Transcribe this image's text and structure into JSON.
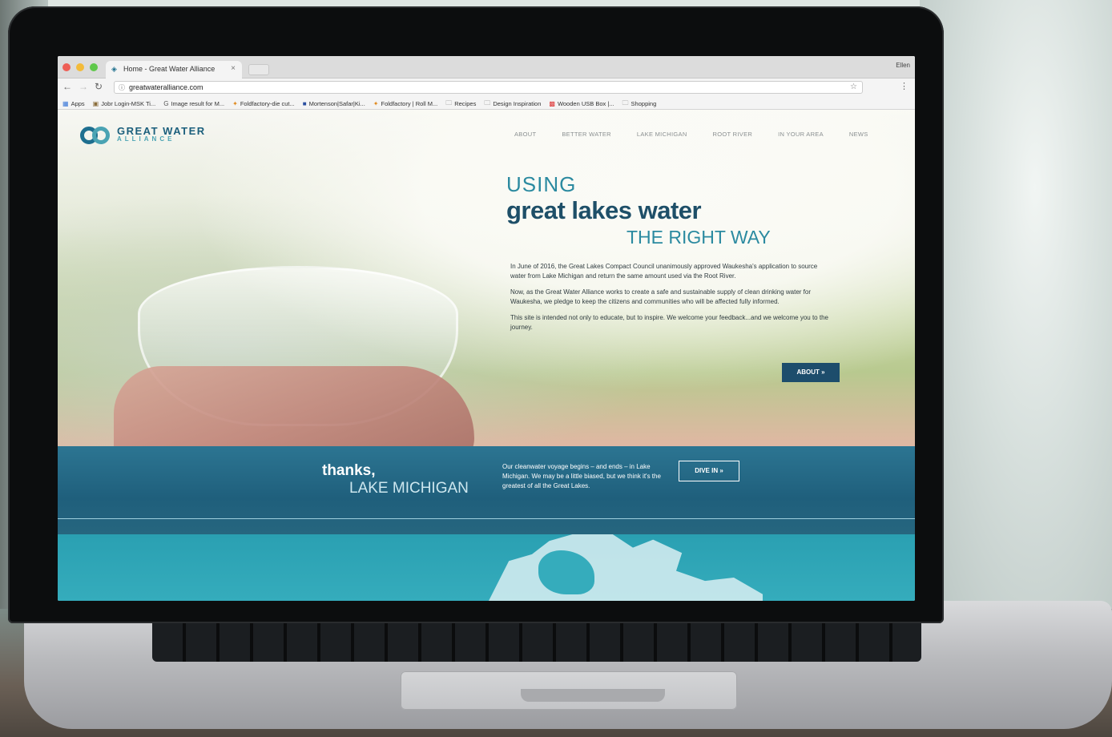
{
  "browser": {
    "tab_title": "Home - Great Water Alliance",
    "tab_close": "×",
    "profile_name": "Ellen",
    "url": "greatwateralliance.com",
    "bookmarks": [
      {
        "label": "Apps"
      },
      {
        "label": "Jobr Login-MSK Ti..."
      },
      {
        "label": "Image result for M..."
      },
      {
        "label": "Foldfactory-die cut..."
      },
      {
        "label": "Mortenson|Safar|Ki..."
      },
      {
        "label": "Foldfactory | Roll M..."
      },
      {
        "label": "Recipes"
      },
      {
        "label": "Design Inspiration"
      },
      {
        "label": "Wooden USB Box |..."
      },
      {
        "label": "Shopping"
      }
    ]
  },
  "site": {
    "logo_line1": "GREAT WATER",
    "logo_line2": "ALLIANCE",
    "nav": [
      "ABOUT",
      "BETTER WATER",
      "LAKE MICHIGAN",
      "ROOT RIVER",
      "IN YOUR AREA",
      "NEWS"
    ],
    "hero": {
      "line1": "USING",
      "line2": "great lakes water",
      "line3": "THE RIGHT WAY",
      "p1": "In June of 2016, the Great Lakes Compact Council unanimously approved Waukesha's application to source water from Lake Michigan and return the same amount used via the Root River.",
      "p2": "Now, as the Great Water Alliance works to create a safe and sustainable supply of clean drinking water for Waukesha, we pledge to keep the citizens and communities who will be affected fully informed.",
      "p3": "This site is intended not only to educate, but to inspire. We welcome your feedback...and we welcome you to the journey.",
      "about_button": "ABOUT »"
    },
    "band": {
      "thanks": "thanks,",
      "lake": "LAKE MICHIGAN",
      "text": "Our cleanwater voyage begins – and ends – in Lake Michigan. We may be a little biased, but we think it's the greatest of all the Great Lakes.",
      "dive_button": "DIVE IN »"
    }
  },
  "colors": {
    "brand_dark": "#1e4f68",
    "brand_teal": "#2b8aa0",
    "band_blue": "#1f5f7c",
    "button_navy": "#1d4d6c"
  }
}
